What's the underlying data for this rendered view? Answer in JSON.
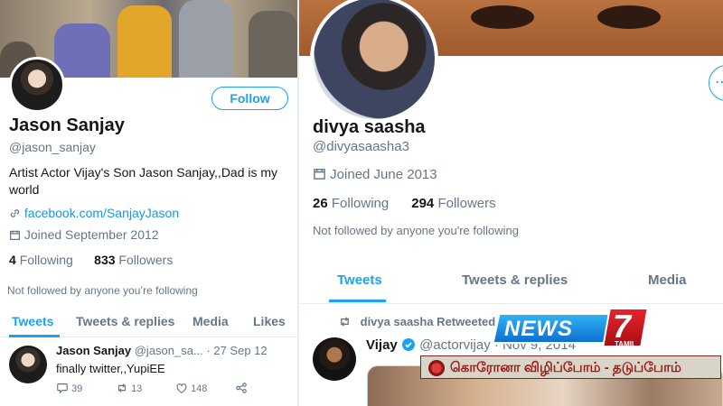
{
  "left_profile": {
    "follow_label": "Follow",
    "name": "Jason Sanjay",
    "handle": "@jason_sanjay",
    "bio": "Artist  Actor Vijay's Son Jason Sanjay,,Dad is my world",
    "link": "facebook.com/SanjayJason",
    "joined": "Joined September 2012",
    "following_count": "4",
    "following_label": "Following",
    "followers_count": "833",
    "followers_label": "Followers",
    "not_followed": "Not followed by anyone you’re following",
    "tabs": [
      "Tweets",
      "Tweets & replies",
      "Media",
      "Likes"
    ],
    "tweet": {
      "name": "Jason Sanjay",
      "handle_date": "@jason_sa... · 27 Sep 12",
      "text": "finally twitter,,YupiEE",
      "replies": "39",
      "retweets": "13",
      "likes": "148"
    }
  },
  "right_profile": {
    "name": "divya saasha",
    "handle": "@divyasaasha3",
    "joined": "Joined June 2013",
    "following_count": "26",
    "following_label": "Following",
    "followers_count": "294",
    "followers_label": "Followers",
    "not_followed": "Not followed by anyone you're following",
    "tabs": [
      "Tweets",
      "Tweets & replies",
      "Media"
    ],
    "retweeted_label": "divya saasha Retweeted",
    "tweet": {
      "name": "Vijay",
      "handle_date": "@actorvijay · Nov 9, 2014"
    }
  },
  "overlay": {
    "logo_word": "NEWS",
    "logo_number": "7",
    "logo_sub": "TAMIL",
    "ticker": "கொரோனா விழிப்போம் - தடுப்போம்"
  },
  "colors": {
    "accent": "#1da1f2",
    "secondary_text": "#657786",
    "news_red": "#d31b22"
  }
}
